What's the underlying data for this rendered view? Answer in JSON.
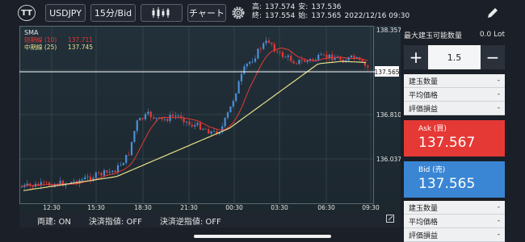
{
  "toolbar": {
    "logo": "TT",
    "symbol": "USDJPY",
    "timeframe": "15分/Bid",
    "chart_type_icon": "candlestick-icon",
    "chart_label": "チャート",
    "settings_icon": "gear-icon",
    "edit_icon": "pencil-icon"
  },
  "quote": {
    "high_label": "高:",
    "high": "137.574",
    "low_label": "安:",
    "low": "137.536",
    "close_label": "終:",
    "close": "137.554",
    "open_label": "始:",
    "open": "137.565",
    "datetime": "2022/12/16 09:30"
  },
  "chart": {
    "indicator": "SMA",
    "ma_short_label": "短期線 (10)",
    "ma_short_value": "137.711",
    "ma_mid_label": "中期線 (25)",
    "ma_mid_value": "137.745",
    "current_price": "137.565",
    "y_ticks": [
      "138.357",
      "136.810",
      "136.037"
    ],
    "x_ticks": [
      "12:30",
      "15:30",
      "18:30",
      "21:30",
      "00:30",
      "03:30",
      "06:30",
      "09:30"
    ],
    "colors": {
      "up": "#4a90d9",
      "down": "#e53935",
      "ma_short": "#e53935",
      "ma_mid": "#e8e08a",
      "bg": "#1e2e35"
    }
  },
  "bottom": {
    "both": "両建: ON",
    "limit": "決済指値: OFF",
    "stop": "決済逆指値: OFF"
  },
  "panel": {
    "max_label": "最大建玉可能数量",
    "max_value": "0.0 Lot",
    "lot_value": "1.5",
    "plus": "+",
    "minus": "−",
    "pos_qty_label": "建玉数量",
    "avg_price_label": "平均価格",
    "pl_label": "評価損益",
    "dash": "-",
    "ask_label": "Ask (買)",
    "ask_price": "137.567",
    "bid_label": "Bid (売)",
    "bid_price": "137.565"
  }
}
